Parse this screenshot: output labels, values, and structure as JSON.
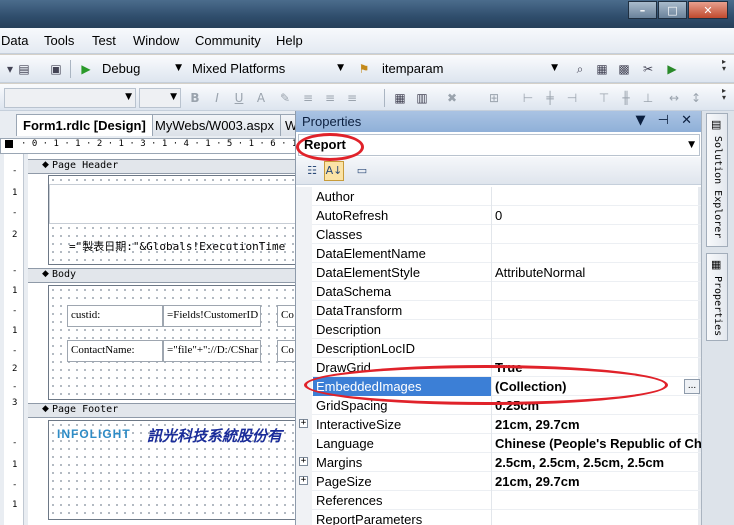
{
  "menu": [
    "Data",
    "Tools",
    "Test",
    "Window",
    "Community",
    "Help"
  ],
  "toolbar": {
    "config": "Debug",
    "platform": "Mixed Platforms",
    "find_value": "itemparam"
  },
  "tabs": [
    "Form1.rdlc [Design]",
    "MyWebs/W003.aspx",
    "W"
  ],
  "ruler_text": "· 0 · 1 · 1 · 2 · 1 · 3 · 1 · 4 · 1 · 5 · 1 · 6 · 1",
  "vruler": [
    "-",
    "1",
    "-",
    "2",
    "-",
    "1",
    "-",
    "1",
    "-",
    "2",
    "-",
    "3",
    "-",
    "1",
    "-",
    "1"
  ],
  "design": {
    "page_header": "Page Header",
    "header_expr": "=\"製表日期:\"&Globals!ExecutionTime",
    "body": "Body",
    "cells": [
      "custid:",
      "=Fields!CustomerID",
      "Co",
      "ContactName:",
      "=\"file\"+\"://D:/CShar",
      "Co"
    ],
    "page_footer": "Page Footer",
    "logo_text": "INFOLIGHT",
    "company_name": "訊光科技系統股份有"
  },
  "properties": {
    "title": "Properties",
    "title_controls": "▼ ⊣ ✕",
    "object": "Report",
    "rows": [
      {
        "name": "Author",
        "value": "",
        "expandable": false,
        "bold": false
      },
      {
        "name": "AutoRefresh",
        "value": "0",
        "expandable": false,
        "bold": false
      },
      {
        "name": "Classes",
        "value": "",
        "expandable": false,
        "bold": false
      },
      {
        "name": "DataElementName",
        "value": "",
        "expandable": false,
        "bold": false
      },
      {
        "name": "DataElementStyle",
        "value": "AttributeNormal",
        "expandable": false,
        "bold": false
      },
      {
        "name": "DataSchema",
        "value": "",
        "expandable": false,
        "bold": false
      },
      {
        "name": "DataTransform",
        "value": "",
        "expandable": false,
        "bold": false
      },
      {
        "name": "Description",
        "value": "",
        "expandable": false,
        "bold": false
      },
      {
        "name": "DescriptionLocID",
        "value": "",
        "expandable": false,
        "bold": false
      },
      {
        "name": "DrawGrid",
        "value": "True",
        "expandable": false,
        "bold": true
      },
      {
        "name": "EmbeddedImages",
        "value": "(Collection)",
        "expandable": false,
        "bold": true,
        "selected": true
      },
      {
        "name": "GridSpacing",
        "value": "0.25cm",
        "expandable": false,
        "bold": true
      },
      {
        "name": "InteractiveSize",
        "value": "21cm, 29.7cm",
        "expandable": true,
        "bold": true
      },
      {
        "name": "Language",
        "value": "Chinese (People's Republic of China)",
        "expandable": false,
        "bold": true
      },
      {
        "name": "Margins",
        "value": "2.5cm, 2.5cm, 2.5cm, 2.5cm",
        "expandable": true,
        "bold": true
      },
      {
        "name": "PageSize",
        "value": "21cm, 29.7cm",
        "expandable": true,
        "bold": true
      },
      {
        "name": "References",
        "value": "",
        "expandable": false,
        "bold": false
      },
      {
        "name": "ReportParameters",
        "value": "",
        "expandable": false,
        "bold": false
      }
    ]
  },
  "dock": [
    "Solution Explorer",
    "Properties"
  ],
  "colors": {
    "highlight_ring": "#e0222a",
    "selection": "#3c7fd6"
  }
}
